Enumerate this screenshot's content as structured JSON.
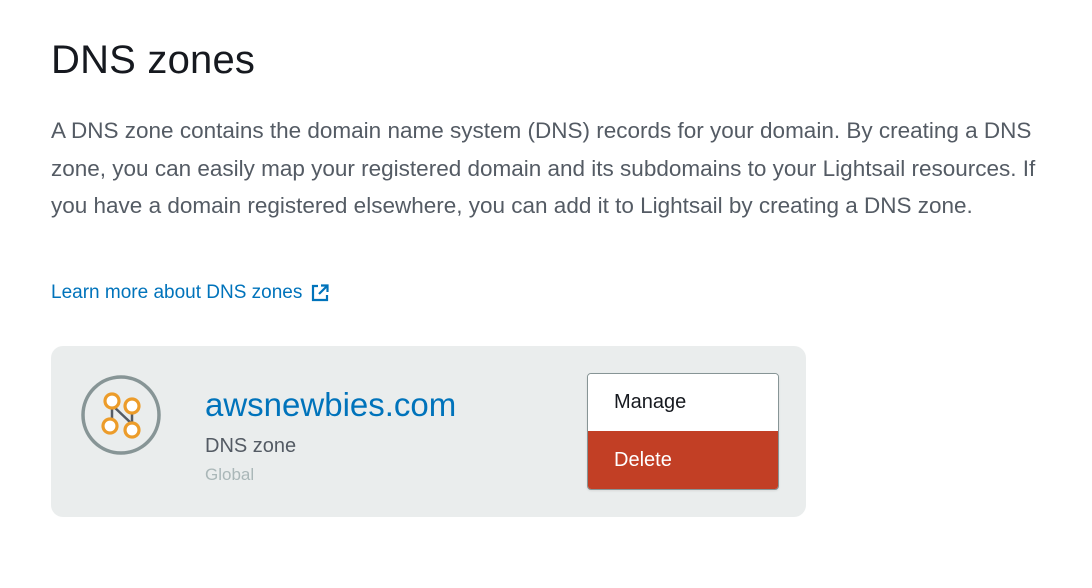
{
  "header": {
    "title": "DNS zones"
  },
  "intro": {
    "description": "A DNS zone contains the domain name system (DNS) records for your domain. By creating a DNS zone, you can easily map your registered domain and its subdomains to your Lightsail resources. If you have a domain registered elsewhere, you can add it to Lightsail by creating a DNS zone.",
    "learn_more_label": "Learn more about DNS zones",
    "learn_more_icon": "external-link-icon"
  },
  "zones": [
    {
      "name": "awsnewbies.com",
      "type": "DNS zone",
      "region": "Global",
      "icon": "dns-zone-icon"
    }
  ],
  "actions_menu": {
    "items": [
      {
        "label": "Manage"
      },
      {
        "label": "Delete"
      }
    ]
  },
  "colors": {
    "link": "#0073bb",
    "card_background": "#eaeded",
    "delete_background": "#c23f25",
    "icon_accent": "#ec9c2a",
    "icon_ring": "#879596"
  }
}
